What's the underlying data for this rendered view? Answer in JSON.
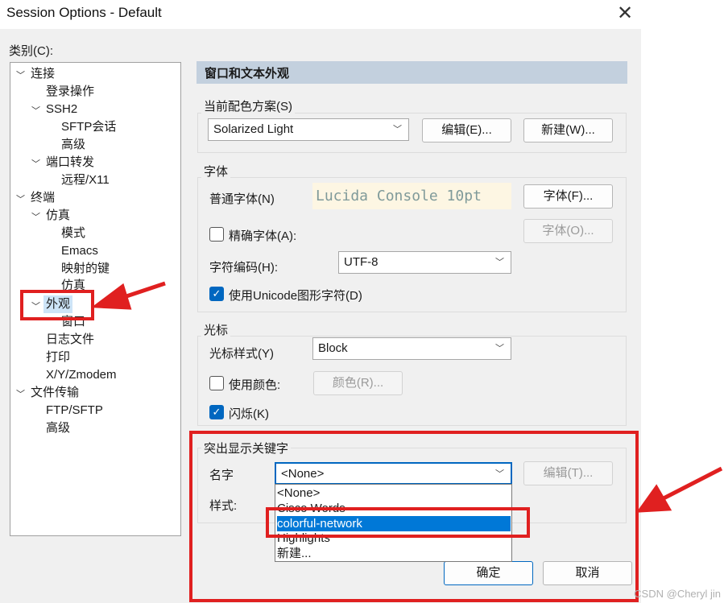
{
  "window": {
    "title": "Session Options - Default",
    "close_glyph": "✕"
  },
  "category_label": "类别(C):",
  "tree": {
    "items": [
      {
        "label": "连接",
        "expanded": true
      },
      {
        "label": "登录操作"
      },
      {
        "label": "SSH2",
        "expanded": true
      },
      {
        "label": "SFTP会话"
      },
      {
        "label": "高级"
      },
      {
        "label": "端口转发",
        "expanded": true
      },
      {
        "label": "远程/X11"
      },
      {
        "label": "终端",
        "expanded": true
      },
      {
        "label": "仿真",
        "expanded": true
      },
      {
        "label": "模式"
      },
      {
        "label": "Emacs"
      },
      {
        "label": "映射的键"
      },
      {
        "label": "仿真"
      },
      {
        "label": "外观",
        "expanded": true,
        "selected": true
      },
      {
        "label": "窗口"
      },
      {
        "label": "日志文件"
      },
      {
        "label": "打印"
      },
      {
        "label": "X/Y/Zmodem"
      },
      {
        "label": "文件传输",
        "expanded": true
      },
      {
        "label": "FTP/SFTP"
      },
      {
        "label": "高级"
      }
    ]
  },
  "section_title": "窗口和文本外观",
  "scheme": {
    "label": "当前配色方案(S)",
    "value": "Solarized Light",
    "edit_button": "编辑(E)...",
    "new_button": "新建(W)..."
  },
  "font": {
    "group_label": "字体",
    "normal_font_label": "普通字体(N)",
    "preview": "Lucida Console 10pt",
    "font_button": "字体(F)...",
    "precise_label": "精确字体(A):",
    "precise_checked": false,
    "precise_button": "字体(O)...",
    "encoding_label": "字符编码(H):",
    "encoding_value": "UTF-8",
    "unicode_label": "使用Unicode图形字符(D)",
    "unicode_checked": true
  },
  "cursor": {
    "group_label": "光标",
    "style_label": "光标样式(Y)",
    "style_value": "Block",
    "use_color_label": "使用颜色:",
    "use_color_checked": false,
    "color_button": "颜色(R)...",
    "blink_label": "闪烁(K)",
    "blink_checked": true
  },
  "highlight": {
    "group_label": "突出显示关键字",
    "name_label": "名字",
    "name_value": "<None>",
    "edit_button": "编辑(T)...",
    "style_label": "样式:",
    "options": [
      "<None>",
      "Cisco Words",
      "colorful-network",
      "Highlights",
      "新建..."
    ],
    "selected_index": 2
  },
  "buttons": {
    "ok": "确定",
    "cancel": "取消"
  },
  "watermark": "CSDN @Cheryl jin",
  "colors": {
    "annotation_red": "#e02020",
    "selection_blue": "#0078d7",
    "header_bg": "#c3d0de"
  },
  "icons": {
    "chevron": "chevron-down-icon",
    "check": "checkmark-icon",
    "arrow": "red-arrow-annotation"
  }
}
